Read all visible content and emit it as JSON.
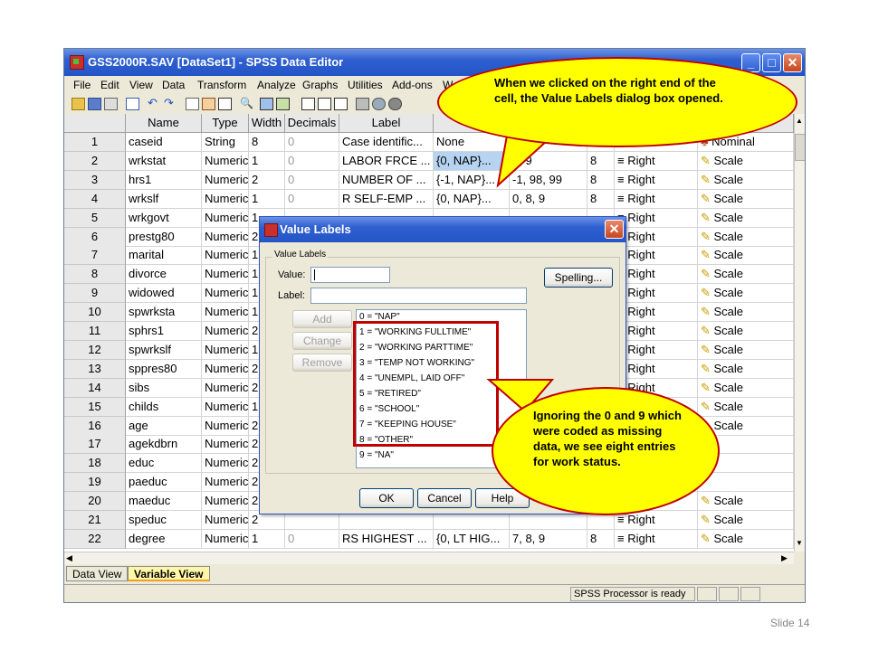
{
  "window": {
    "title": "GSS2000R.SAV [DataSet1] - SPSS Data Editor"
  },
  "menu": [
    "File",
    "Edit",
    "View",
    "Data",
    "Transform",
    "Analyze",
    "Graphs",
    "Utilities",
    "Add-ons",
    "W"
  ],
  "columns": [
    "Name",
    "Type",
    "Width",
    "Decimals",
    "Label",
    "V"
  ],
  "rows": [
    {
      "num": "1",
      "name": "caseid",
      "type": "String",
      "width": "8",
      "decimals": "0",
      "label": "Case identific...",
      "values": "None",
      "missing": "",
      "columns": "",
      "align": "",
      "measure": "Nominal"
    },
    {
      "num": "2",
      "name": "wrkstat",
      "type": "Numeric",
      "width": "1",
      "decimals": "0",
      "label": "LABOR FRCE ...",
      "values": "{0, NAP}...",
      "missing": "0, 9",
      "columns": "8",
      "align": "Right",
      "measure": "Scale"
    },
    {
      "num": "3",
      "name": "hrs1",
      "type": "Numeric",
      "width": "2",
      "decimals": "0",
      "label": "NUMBER OF ...",
      "values": "{-1, NAP}...",
      "missing": "-1, 98, 99",
      "columns": "8",
      "align": "Right",
      "measure": "Scale"
    },
    {
      "num": "4",
      "name": "wrkslf",
      "type": "Numeric",
      "width": "1",
      "decimals": "0",
      "label": "R SELF-EMP ...",
      "values": "{0, NAP}...",
      "missing": "0, 8, 9",
      "columns": "8",
      "align": "Right",
      "measure": "Scale"
    },
    {
      "num": "5",
      "name": "wrkgovt",
      "type": "Numeric",
      "width": "1",
      "decimals": "",
      "label": "",
      "values": "",
      "missing": "",
      "columns": "",
      "align": "Right",
      "measure": "Scale"
    },
    {
      "num": "6",
      "name": "prestg80",
      "type": "Numeric",
      "width": "2",
      "decimals": "",
      "label": "",
      "values": "",
      "missing": "",
      "columns": "",
      "align": "Right",
      "measure": "Scale"
    },
    {
      "num": "7",
      "name": "marital",
      "type": "Numeric",
      "width": "1",
      "decimals": "",
      "label": "",
      "values": "",
      "missing": "",
      "columns": "",
      "align": "Right",
      "measure": "Scale"
    },
    {
      "num": "8",
      "name": "divorce",
      "type": "Numeric",
      "width": "1",
      "decimals": "",
      "label": "",
      "values": "",
      "missing": "",
      "columns": "",
      "align": "Right",
      "measure": "Scale"
    },
    {
      "num": "9",
      "name": "widowed",
      "type": "Numeric",
      "width": "1",
      "decimals": "",
      "label": "",
      "values": "",
      "missing": "",
      "columns": "",
      "align": "Right",
      "measure": "Scale"
    },
    {
      "num": "10",
      "name": "spwrksta",
      "type": "Numeric",
      "width": "1",
      "decimals": "",
      "label": "",
      "values": "",
      "missing": "",
      "columns": "",
      "align": "Right",
      "measure": "Scale"
    },
    {
      "num": "11",
      "name": "sphrs1",
      "type": "Numeric",
      "width": "2",
      "decimals": "",
      "label": "",
      "values": "",
      "missing": "",
      "columns": "",
      "align": "Right",
      "measure": "Scale"
    },
    {
      "num": "12",
      "name": "spwrkslf",
      "type": "Numeric",
      "width": "1",
      "decimals": "",
      "label": "",
      "values": "",
      "missing": "",
      "columns": "",
      "align": "Right",
      "measure": "Scale"
    },
    {
      "num": "13",
      "name": "sppres80",
      "type": "Numeric",
      "width": "2",
      "decimals": "",
      "label": "",
      "values": "",
      "missing": "",
      "columns": "",
      "align": "Right",
      "measure": "Scale"
    },
    {
      "num": "14",
      "name": "sibs",
      "type": "Numeric",
      "width": "2",
      "decimals": "",
      "label": "",
      "values": "",
      "missing": "",
      "columns": "",
      "align": "Right",
      "measure": "Scale"
    },
    {
      "num": "15",
      "name": "childs",
      "type": "Numeric",
      "width": "1",
      "decimals": "",
      "label": "",
      "values": "",
      "missing": "",
      "columns": "",
      "align": "",
      "measure": "Scale"
    },
    {
      "num": "16",
      "name": "age",
      "type": "Numeric",
      "width": "2",
      "decimals": "",
      "label": "",
      "values": "",
      "missing": "",
      "columns": "",
      "align": "",
      "measure": "Scale"
    },
    {
      "num": "17",
      "name": "agekdbrn",
      "type": "Numeric",
      "width": "2",
      "decimals": "",
      "label": "",
      "values": "",
      "missing": "",
      "columns": "",
      "align": "",
      "measure": ""
    },
    {
      "num": "18",
      "name": "educ",
      "type": "Numeric",
      "width": "2",
      "decimals": "",
      "label": "",
      "values": "",
      "missing": "",
      "columns": "",
      "align": "",
      "measure": ""
    },
    {
      "num": "19",
      "name": "paeduc",
      "type": "Numeric",
      "width": "2",
      "decimals": "",
      "label": "",
      "values": "",
      "missing": "",
      "columns": "",
      "align": "",
      "measure": ""
    },
    {
      "num": "20",
      "name": "maeduc",
      "type": "Numeric",
      "width": "2",
      "decimals": "",
      "label": "",
      "values": "",
      "missing": "",
      "columns": "",
      "align": "",
      "measure": "Scale"
    },
    {
      "num": "21",
      "name": "speduc",
      "type": "Numeric",
      "width": "2",
      "decimals": "",
      "label": "",
      "values": "",
      "missing": "",
      "columns": "",
      "align": "Right",
      "measure": "Scale"
    },
    {
      "num": "22",
      "name": "degree",
      "type": "Numeric",
      "width": "1",
      "decimals": "0",
      "label": "RS HIGHEST ...",
      "values": "{0, LT HIG...",
      "missing": "7, 8, 9",
      "columns": "8",
      "align": "Right",
      "measure": "Scale"
    }
  ],
  "dialog": {
    "title": "Value Labels",
    "group": "Value Labels",
    "value_label": "Value:",
    "label_label": "Label:",
    "spelling": "Spelling...",
    "add": "Add",
    "change": "Change",
    "remove": "Remove",
    "ok": "OK",
    "cancel": "Cancel",
    "help": "Help",
    "items": [
      "0 = \"NAP\"",
      "1 = \"WORKING FULLTIME\"",
      "2 = \"WORKING PARTTIME\"",
      "3 = \"TEMP NOT WORKING\"",
      "4 = \"UNEMPL, LAID OFF\"",
      "5 = \"RETIRED\"",
      "6 = \"SCHOOL\"",
      "7 = \"KEEPING HOUSE\"",
      "8 = \"OTHER\"",
      "9 = \"NA\""
    ]
  },
  "tabs": {
    "data_view": "Data View",
    "variable_view": "Variable View"
  },
  "status": "SPSS  Processor is ready",
  "callout_top": "When we clicked on the right end of the cell, the Value Labels dialog box opened.",
  "callout_bottom": "Ignoring the 0 and 9 which were coded as missing data, we see eight entries for work status.",
  "slide": "Slide 14",
  "colors": {
    "accent_red": "#c00000",
    "callout": "#ffff00",
    "titlebar": "#2f5fd0"
  }
}
